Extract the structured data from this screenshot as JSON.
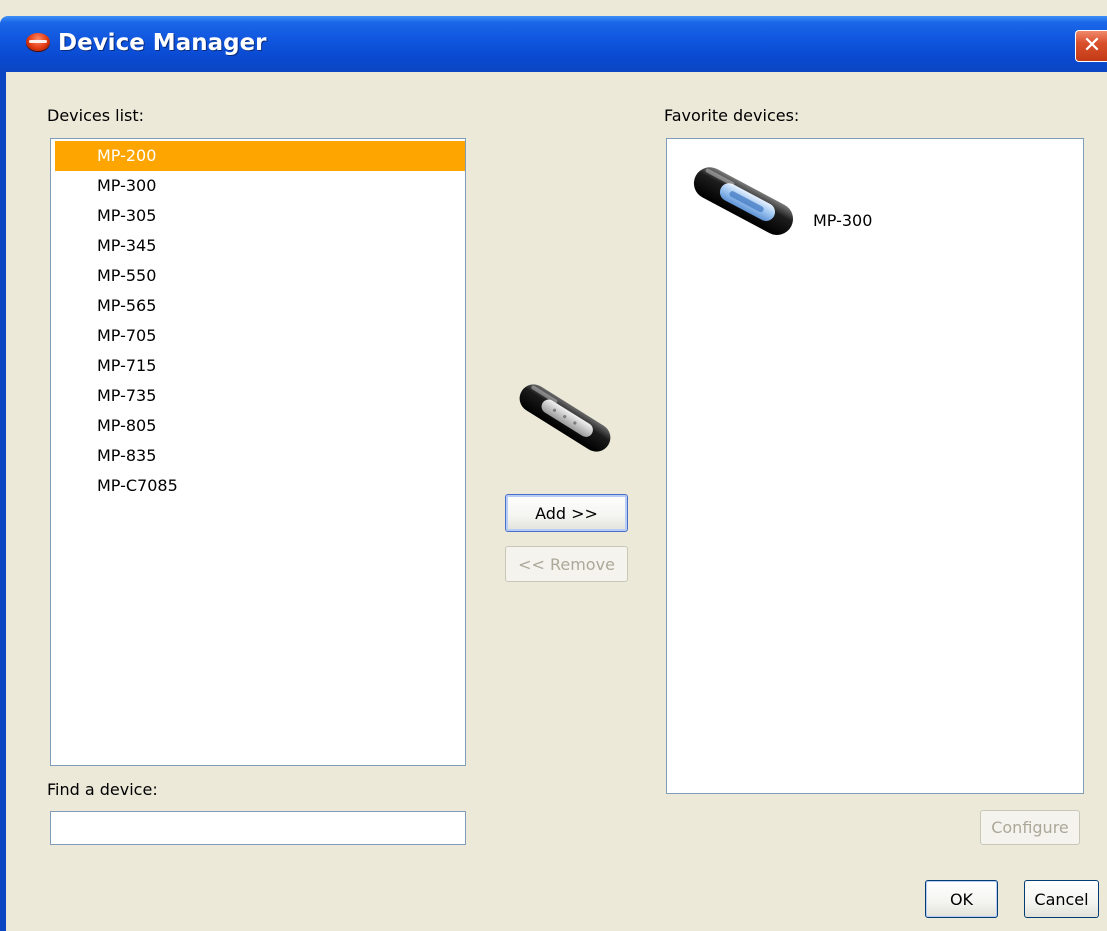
{
  "window": {
    "title": "Device Manager",
    "close_glyph": "✕",
    "icon": "app-orb-icon"
  },
  "devices": {
    "label": "Devices list:",
    "items": [
      "MP-200",
      "MP-300",
      "MP-305",
      "MP-345",
      "MP-550",
      "MP-565",
      "MP-705",
      "MP-715",
      "MP-735",
      "MP-805",
      "MP-835",
      "MP-C7085"
    ],
    "selected": "MP-200"
  },
  "find": {
    "label": "Find a device:",
    "value": ""
  },
  "buttons": {
    "add": "Add >>",
    "remove": "<< Remove",
    "configure": "Configure",
    "ok": "OK",
    "cancel": "Cancel"
  },
  "favorites": {
    "label": "Favorite devices:",
    "items": [
      {
        "name": "MP-300",
        "icon": "media-player-icon"
      }
    ]
  },
  "colors": {
    "selection": "#FFA500",
    "titlebar": "#0A49D1",
    "face": "#ECE9D8"
  }
}
